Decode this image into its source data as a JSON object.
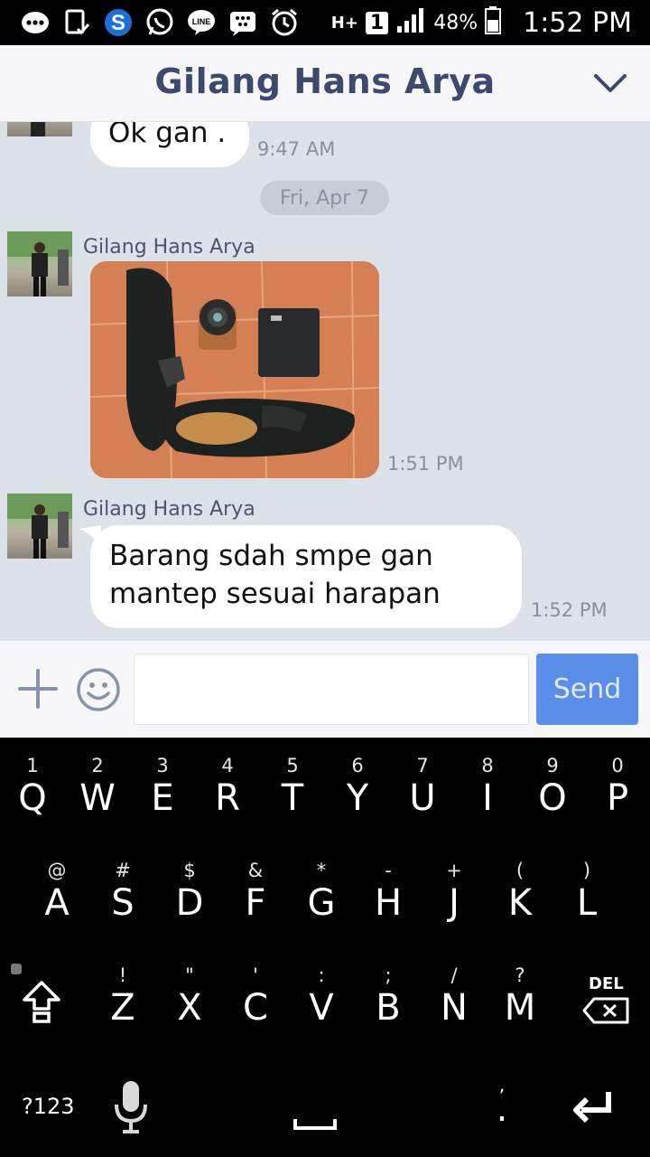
{
  "status_bar": {
    "battery": "48%",
    "time": "1:52 PM",
    "network": "H+",
    "sim": "1",
    "icons": [
      "messenger-icon",
      "clipboard-check-icon",
      "skype-icon",
      "whatsapp-icon",
      "line-icon",
      "bbm-icon",
      "alarm-icon"
    ]
  },
  "header": {
    "title": "Gilang Hans Arya"
  },
  "messages": {
    "m1": {
      "text": "Ok gan .",
      "time": "9:47 AM"
    },
    "date_divider": "Fri, Apr 7",
    "m2": {
      "sender": "Gilang Hans Arya",
      "time": "1:51 PM"
    },
    "m3": {
      "sender": "Gilang Hans Arya",
      "line1": "Barang sdah smpe gan",
      "line2": "mantep sesuai harapan",
      "time": "1:52 PM"
    }
  },
  "input": {
    "placeholder": "",
    "send_label": "Send"
  },
  "keyboard": {
    "row1": [
      [
        "1",
        "Q"
      ],
      [
        "2",
        "W"
      ],
      [
        "3",
        "E"
      ],
      [
        "4",
        "R"
      ],
      [
        "5",
        "T"
      ],
      [
        "6",
        "Y"
      ],
      [
        "7",
        "U"
      ],
      [
        "8",
        "I"
      ],
      [
        "9",
        "O"
      ],
      [
        "0",
        "P"
      ]
    ],
    "row2": [
      [
        "@",
        "A"
      ],
      [
        "#",
        "S"
      ],
      [
        "$",
        "D"
      ],
      [
        "&",
        "F"
      ],
      [
        "*",
        "G"
      ],
      [
        "-",
        "H"
      ],
      [
        "+",
        "J"
      ],
      [
        "(",
        "K"
      ],
      [
        ")",
        "L"
      ]
    ],
    "row3": [
      [
        "!",
        "Z"
      ],
      [
        "\"",
        "X"
      ],
      [
        "'",
        "C"
      ],
      [
        ":",
        "V"
      ],
      [
        ";",
        "B"
      ],
      [
        "/",
        "N"
      ],
      [
        "?",
        "M"
      ]
    ],
    "mode_label": "?123",
    "del_label": "DEL",
    "period_hint": ",",
    "period": "."
  },
  "colors": {
    "accent": "#5a8ee8",
    "header_text": "#3c4a6e",
    "chat_bg": "#dde2ea"
  }
}
